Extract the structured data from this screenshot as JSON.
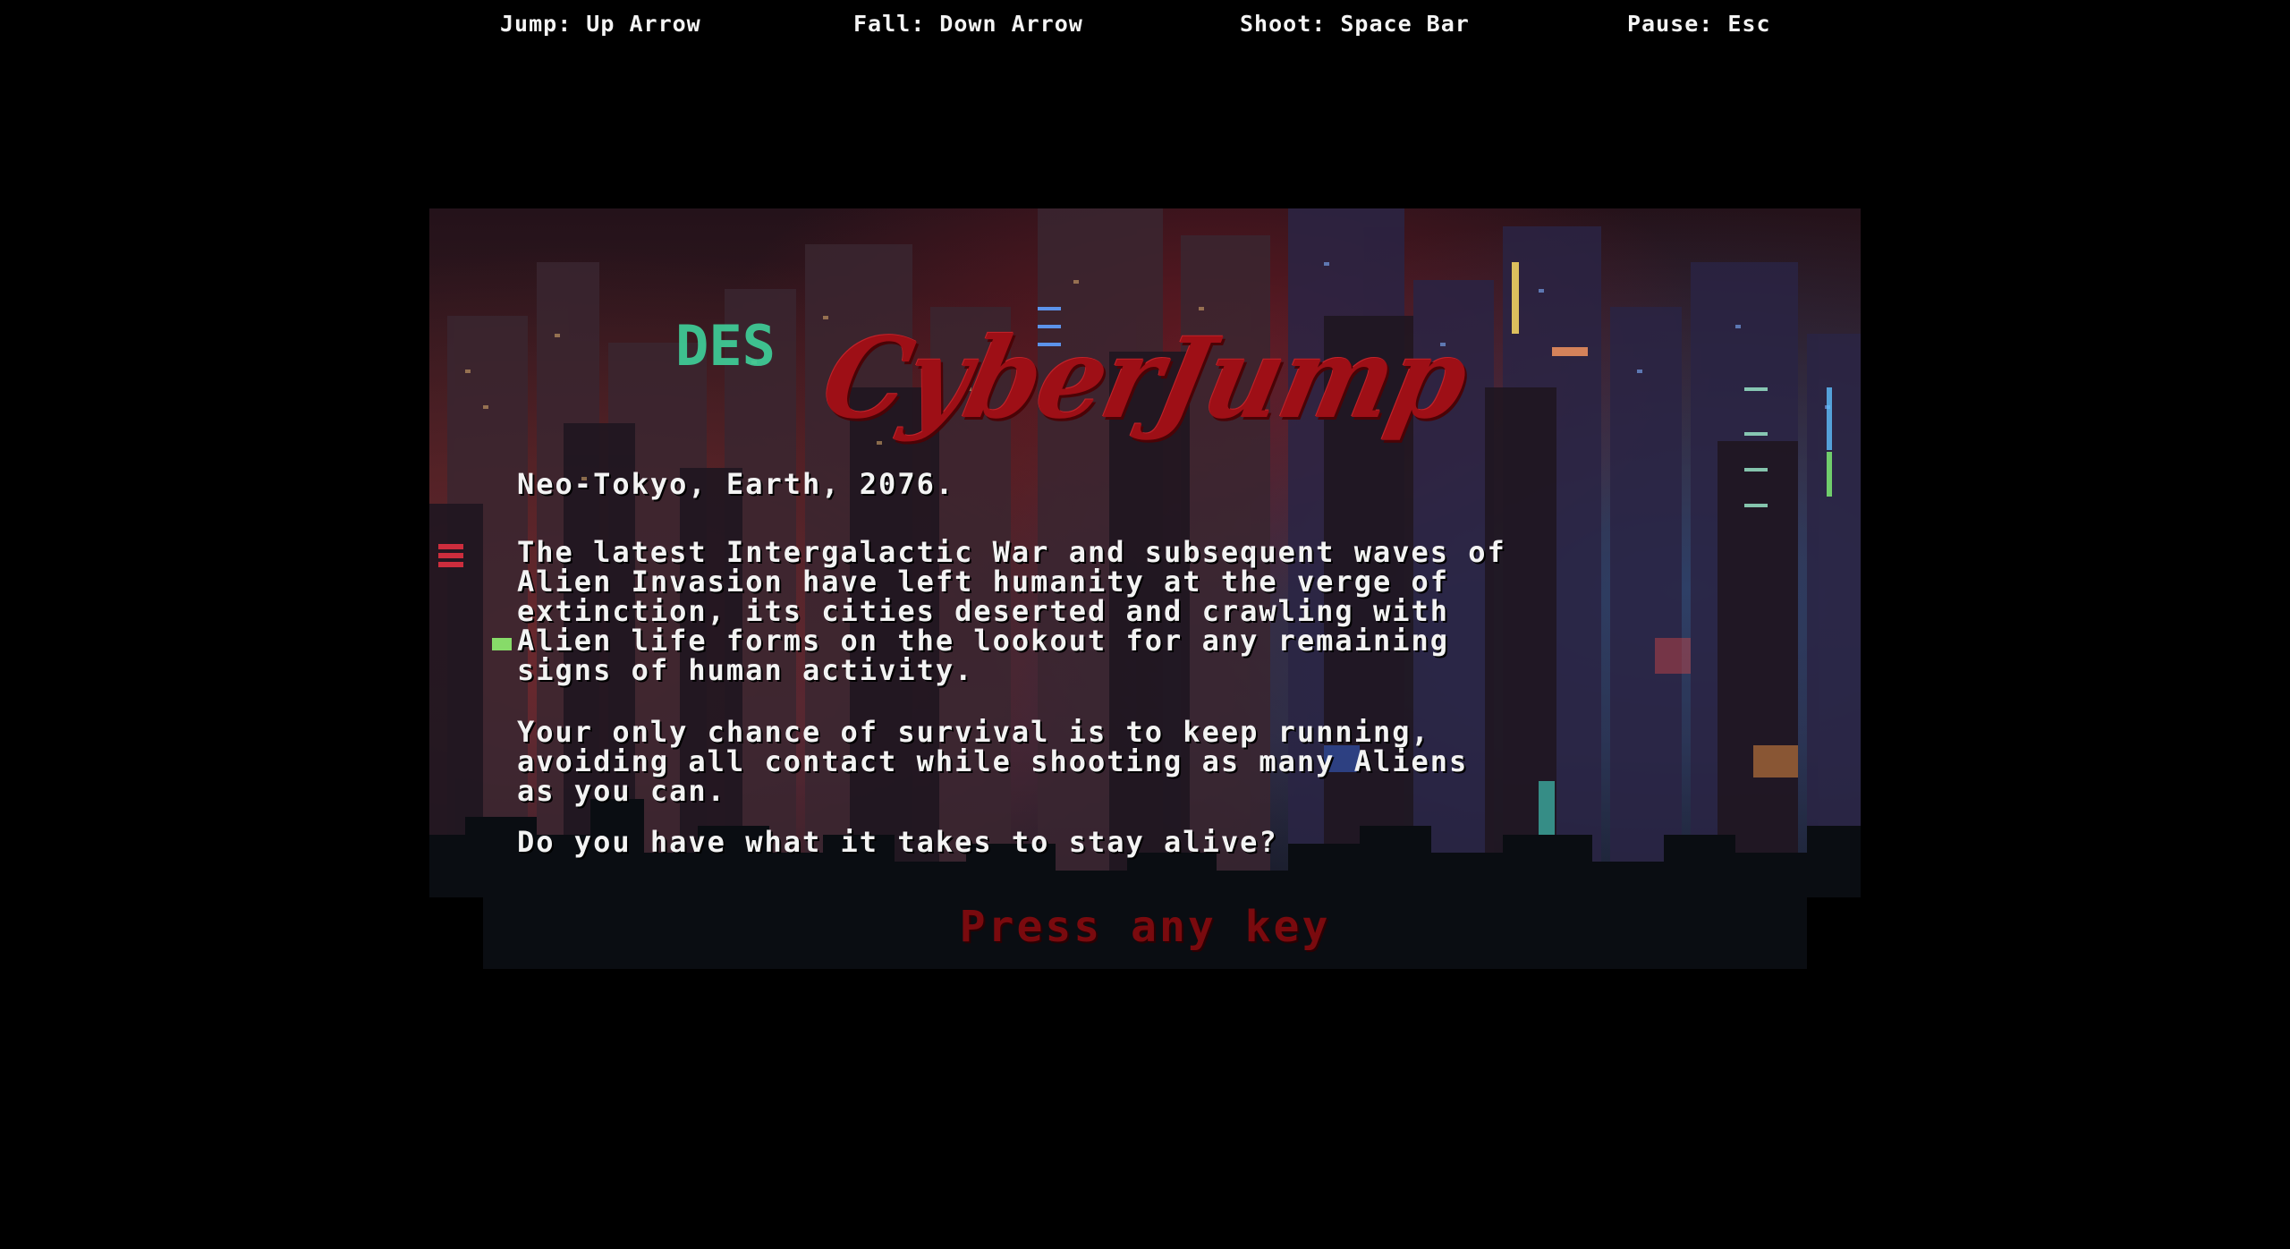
{
  "controls": [
    {
      "label": "Jump: Up Arrow"
    },
    {
      "label": "Fall: Down Arrow"
    },
    {
      "label": "Shoot: Space Bar"
    },
    {
      "label": "Pause: Esc"
    }
  ],
  "game": {
    "title": "CyberJump",
    "story": {
      "intro": "Neo-Tokyo, Earth, 2076.",
      "paragraph1": "The latest Intergalactic War and subsequent waves of\nAlien Invasion have left humanity at the verge of\nextinction, its cities deserted and crawling with\nAlien life forms on the lookout for any remaining\nsigns of human activity.",
      "paragraph2": "Your only chance of survival is to keep running,\navoiding all contact while shooting as many Aliens\nas you can.",
      "question": "Do you have what it takes to stay alive?"
    },
    "prompt": "Press any key",
    "sign_text": "DES"
  },
  "colors": {
    "background": "#000000",
    "title": "#9e0f16",
    "prompt": "#7a0a0e",
    "text": "#f3f3f3",
    "neon_green": "#3fd19a"
  }
}
